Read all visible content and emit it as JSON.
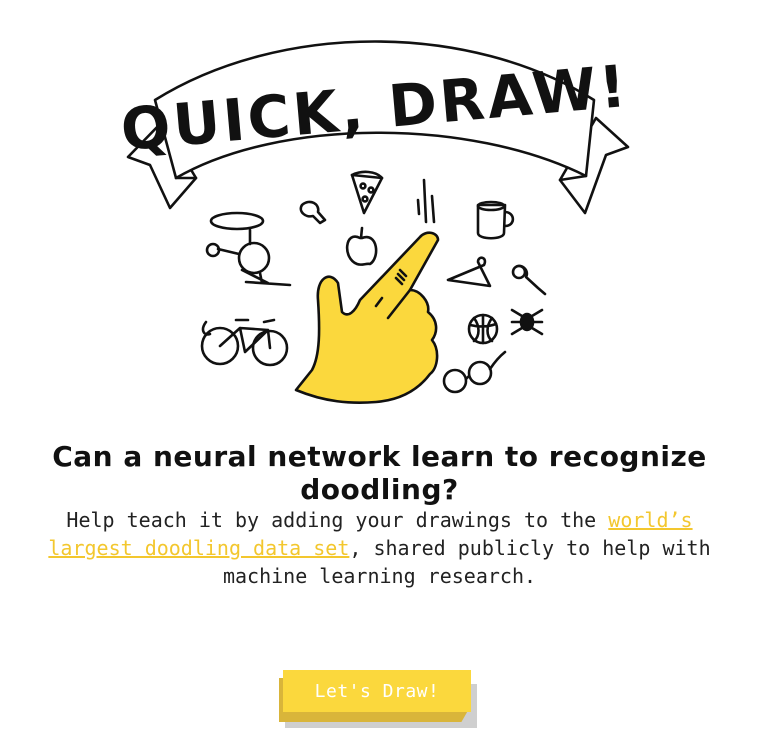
{
  "banner": {
    "title": "QUICK, DRAW!"
  },
  "headline": "Can a neural network learn to recognize doodling?",
  "description": {
    "before": "Help teach it by adding your drawings to the ",
    "link": "world’s largest doodling data set",
    "after": ", shared publicly to help with machine learning research."
  },
  "cta": {
    "label": "Let's Draw!"
  },
  "colors": {
    "accent": "#fbd83d",
    "accent_dark": "#d9b53a",
    "link": "#f3c72e",
    "ink": "#111111"
  },
  "doodles": [
    "helicopter-icon",
    "flashlight-icon",
    "pizza-icon",
    "apple-icon",
    "mug-icon",
    "hanger-icon",
    "pushpin-icon",
    "bicycle-icon",
    "basketball-icon",
    "spider-icon",
    "eyeglasses-icon",
    "hand-pointer-icon"
  ]
}
